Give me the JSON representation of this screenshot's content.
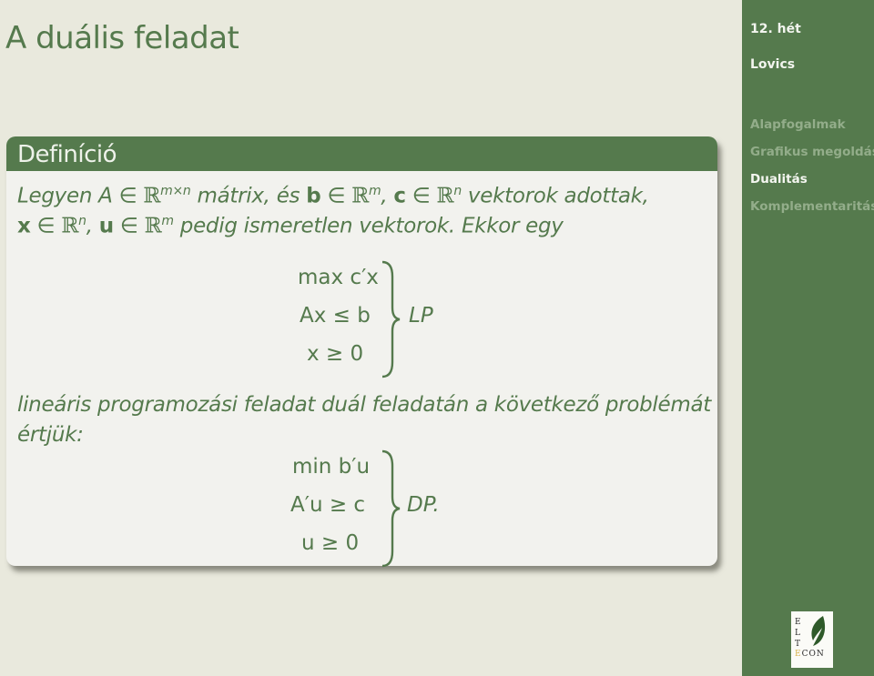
{
  "frame": {
    "title": "A duális feladat"
  },
  "sidebar": {
    "week": "12. hét",
    "author": "Lovics",
    "nav": [
      {
        "label": "Alapfogalmak",
        "active": false
      },
      {
        "label": "Grafikus megoldás",
        "active": false
      },
      {
        "label": "Dualitás",
        "active": true
      },
      {
        "label": "Komplementaritás",
        "active": false
      }
    ],
    "logo": {
      "letters": [
        "E",
        "L",
        "T"
      ],
      "econ": "ECON"
    }
  },
  "definition": {
    "title": "Definíció",
    "line1": {
      "a": "Legyen ",
      "A": "A",
      "in1": " ∈ ",
      "R1": "ℝ",
      "sup1": "m×n",
      "b": " mátrix, és ",
      "bvec": "b",
      "in2": " ∈ ",
      "R2": "ℝ",
      "sup2": "m",
      "c": ", ",
      "cvec": "c",
      "in3": " ∈ ",
      "R3": "ℝ",
      "sup3": "n",
      "d": " vektorok adottak,"
    },
    "line2": {
      "xvec": "x",
      "in1": " ∈ ",
      "R1": "ℝ",
      "sup1": "n",
      "comma": ", ",
      "uvec": "u",
      "in2": " ∈ ",
      "R2": "ℝ",
      "sup2": "m",
      "rest": " pedig ismeretlen vektorok. Ekkor egy"
    },
    "primal": {
      "rows": [
        "max c′x",
        "Ax ≤ b",
        "x ≥ 0"
      ],
      "label": "LP"
    },
    "line3": "lineáris programozási feladat duál feladatán a következő problémát",
    "line4": "értjük:",
    "dual": {
      "rows": [
        "min b′u",
        "A′u ≥ c",
        "u ≥ 0"
      ],
      "label": "DP."
    }
  }
}
